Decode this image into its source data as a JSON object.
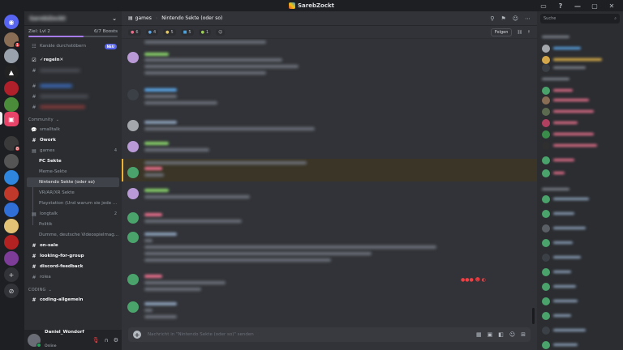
{
  "window": {
    "title": "SarebZockt"
  },
  "sidebar": {
    "server_name": "SarebZockt",
    "boost_level": "Ziel: Lvl 2",
    "boost_count": "6/7 Boosts",
    "browse_channels": "Kanäle durchstöbern",
    "new_badge": "NEU",
    "regeln": "✓regeln✕",
    "category_community": "Community",
    "channels": {
      "smalltalk": "smalltalk",
      "owork": "Owork",
      "games": "games",
      "pc_sekte": "PC Sekte",
      "meme_sekte": "Meme-Sekte",
      "nintendo": "Nintendo Sekte (oder so)",
      "vr": "VR/AR/XR Sekte",
      "playstation": "Playstation (Und warum sie jede ...",
      "longtalk": "longtalk",
      "politik": "Politik",
      "dumme": "Dumme, deutsche Videospielmag...",
      "on_sale": "on-sale",
      "looking": "looking-for-group",
      "feedback": "discord-feedback",
      "rolea": "rolea"
    },
    "games_count": "4",
    "longtalk_count": "2",
    "category_coding": "CODING",
    "coding_allgemein": "coding-allgemein"
  },
  "user": {
    "name": "Daniel_Wondorf",
    "status": "Online"
  },
  "header": {
    "parent": "games",
    "thread": "Nintendo Sekte (oder so)"
  },
  "forum": {
    "tags": [
      "6",
      "4",
      "5",
      "5",
      "1"
    ],
    "follow": "Folgen"
  },
  "composer": {
    "placeholder": "Nachricht in \"Nintendo Sekte (oder so)\" senden"
  },
  "members": {
    "search_placeholder": "Suche"
  },
  "colors": {
    "accent": "#5865f2",
    "online": "#23a559",
    "danger": "#f23f43",
    "highlight": "#f0b232"
  }
}
